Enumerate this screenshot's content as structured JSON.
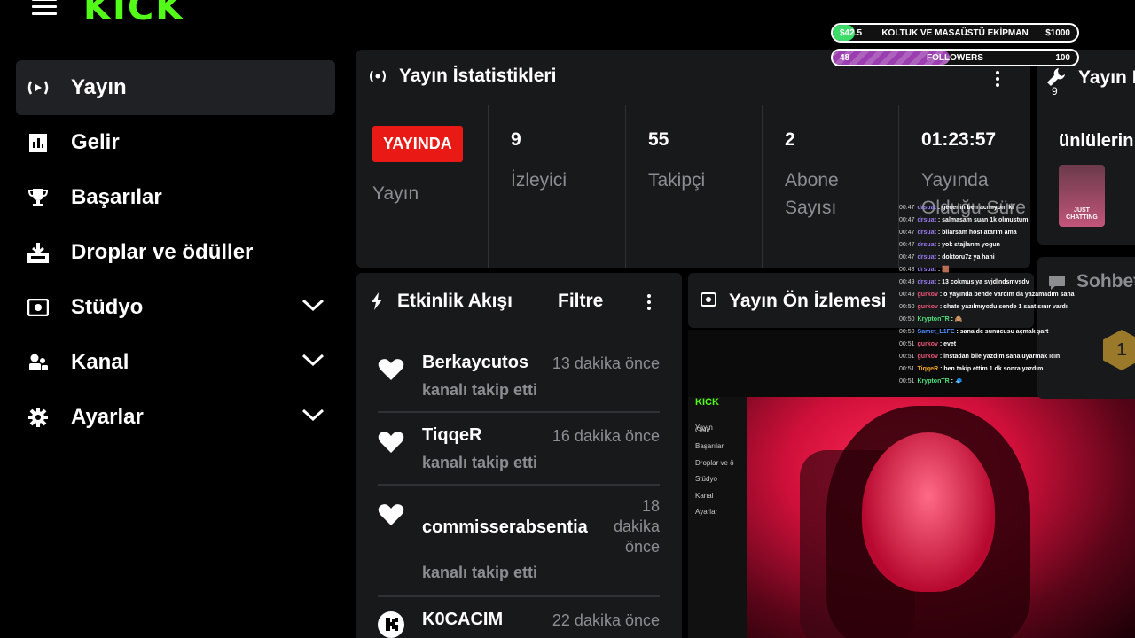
{
  "logo": "KICK",
  "sidebar": {
    "items": [
      {
        "label": "Yayın",
        "icon": "live-icon"
      },
      {
        "label": "Gelir",
        "icon": "chart-icon"
      },
      {
        "label": "Başarılar",
        "icon": "trophy-icon"
      },
      {
        "label": "Droplar ve ödüller",
        "icon": "gift-icon"
      },
      {
        "label": "Stüdyo",
        "icon": "studio-icon"
      },
      {
        "label": "Kanal",
        "icon": "users-icon"
      },
      {
        "label": "Ayarlar",
        "icon": "gear-icon"
      }
    ]
  },
  "stats": {
    "title": "Yayın İstatistikleri",
    "badge": "YAYINDA",
    "badge_label": "Yayın",
    "items": [
      {
        "value": "9",
        "label": "İzleyici"
      },
      {
        "value": "55",
        "label": "Takipçi"
      },
      {
        "value": "2",
        "label": "Abone Sayısı"
      },
      {
        "value": "01:23:57",
        "label": "Yayında Olduğu Süre"
      }
    ]
  },
  "activity": {
    "title": "Etkinlik Akışı",
    "filter": "Filtre",
    "items": [
      {
        "name": "Berkaycutos",
        "time": "13 dakika önce",
        "desc": "kanalı takip etti"
      },
      {
        "name": "TiqqeR",
        "time": "16 dakika önce",
        "desc": "kanalı takip etti"
      },
      {
        "name": "commisserabsentia",
        "time": "18 dakika önce",
        "desc": "kanalı takip etti"
      },
      {
        "name": "K0CACIM",
        "time": "22 dakika önce",
        "desc": ""
      }
    ]
  },
  "preview": {
    "title": "Yayın Ön İzlemesi"
  },
  "right_panel": {
    "title": "Yayın B",
    "count": "9",
    "subtitle": "ünlülerin",
    "card_tag": "JUST CHATTING",
    "chat_title": "Sohbet",
    "badge": "1"
  },
  "goals": [
    {
      "left": "$42.5",
      "title": "KOLTUK VE MASAÜSTÜ EKİPMAN",
      "right": "$1000",
      "progress": 0.0425,
      "color": "#3ddc6a"
    },
    {
      "left": "48",
      "title": "FOLLOWERS",
      "right": "100",
      "progress": 0.48,
      "color": "#9b3fb0"
    }
  ],
  "mini_ui": [
    "Yayın",
    "Gelir",
    "Başarılar",
    "Droplar ve ö",
    "Stüdyo",
    "Kanal",
    "Ayarlar"
  ],
  "chat": [
    {
      "ts": "00:47",
      "user": "drsuat",
      "color": "#9b7cf5",
      "msg": "geçenin ben acmıyom ki"
    },
    {
      "ts": "00:47",
      "user": "drsuat",
      "color": "#9b7cf5",
      "msg": "salmasam suan 1k olmustum"
    },
    {
      "ts": "00:47",
      "user": "drsuat",
      "color": "#9b7cf5",
      "msg": "bilarsam host atarım ama"
    },
    {
      "ts": "00:47",
      "user": "drsuat",
      "color": "#9b7cf5",
      "msg": "yok stajlarım yogun"
    },
    {
      "ts": "00:47",
      "user": "drsuat",
      "color": "#9b7cf5",
      "msg": "doktoru7z ya hani"
    },
    {
      "ts": "00:48",
      "user": "drsuat",
      "color": "#9b7cf5",
      "msg": "🟫"
    },
    {
      "ts": "00:49",
      "user": "drsuat",
      "color": "#9b7cf5",
      "msg": "13 cokmus ya svjdlndsmvsdv"
    },
    {
      "ts": "00:49",
      "user": "gurkov",
      "color": "#f0567a",
      "msg": "o yayında bende vardım da yazamadım sana"
    },
    {
      "ts": "00:50",
      "user": "gurkov",
      "color": "#f0567a",
      "msg": "chate yazılmıyodu sende 1 saat sınır vardı"
    },
    {
      "ts": "00:50",
      "user": "KryptonTR",
      "color": "#4fe07a",
      "msg": "🙈"
    },
    {
      "ts": "00:50",
      "user": "Samet_L1FE",
      "color": "#4f8cff",
      "msg": "sana dc sunucusu açmak şart"
    },
    {
      "ts": "00:51",
      "user": "gurkov",
      "color": "#f0567a",
      "msg": "evet"
    },
    {
      "ts": "00:51",
      "user": "gurkov",
      "color": "#f0567a",
      "msg": "instadan bile yazdım sana uyarmak ıcın"
    },
    {
      "ts": "00:51",
      "user": "TiqqeR",
      "color": "#f5a623",
      "msg": "ben takip ettim 1 dk sonra yazdım"
    },
    {
      "ts": "00:51",
      "user": "KryptonTR",
      "color": "#4fe07a",
      "msg": "🧢"
    }
  ]
}
